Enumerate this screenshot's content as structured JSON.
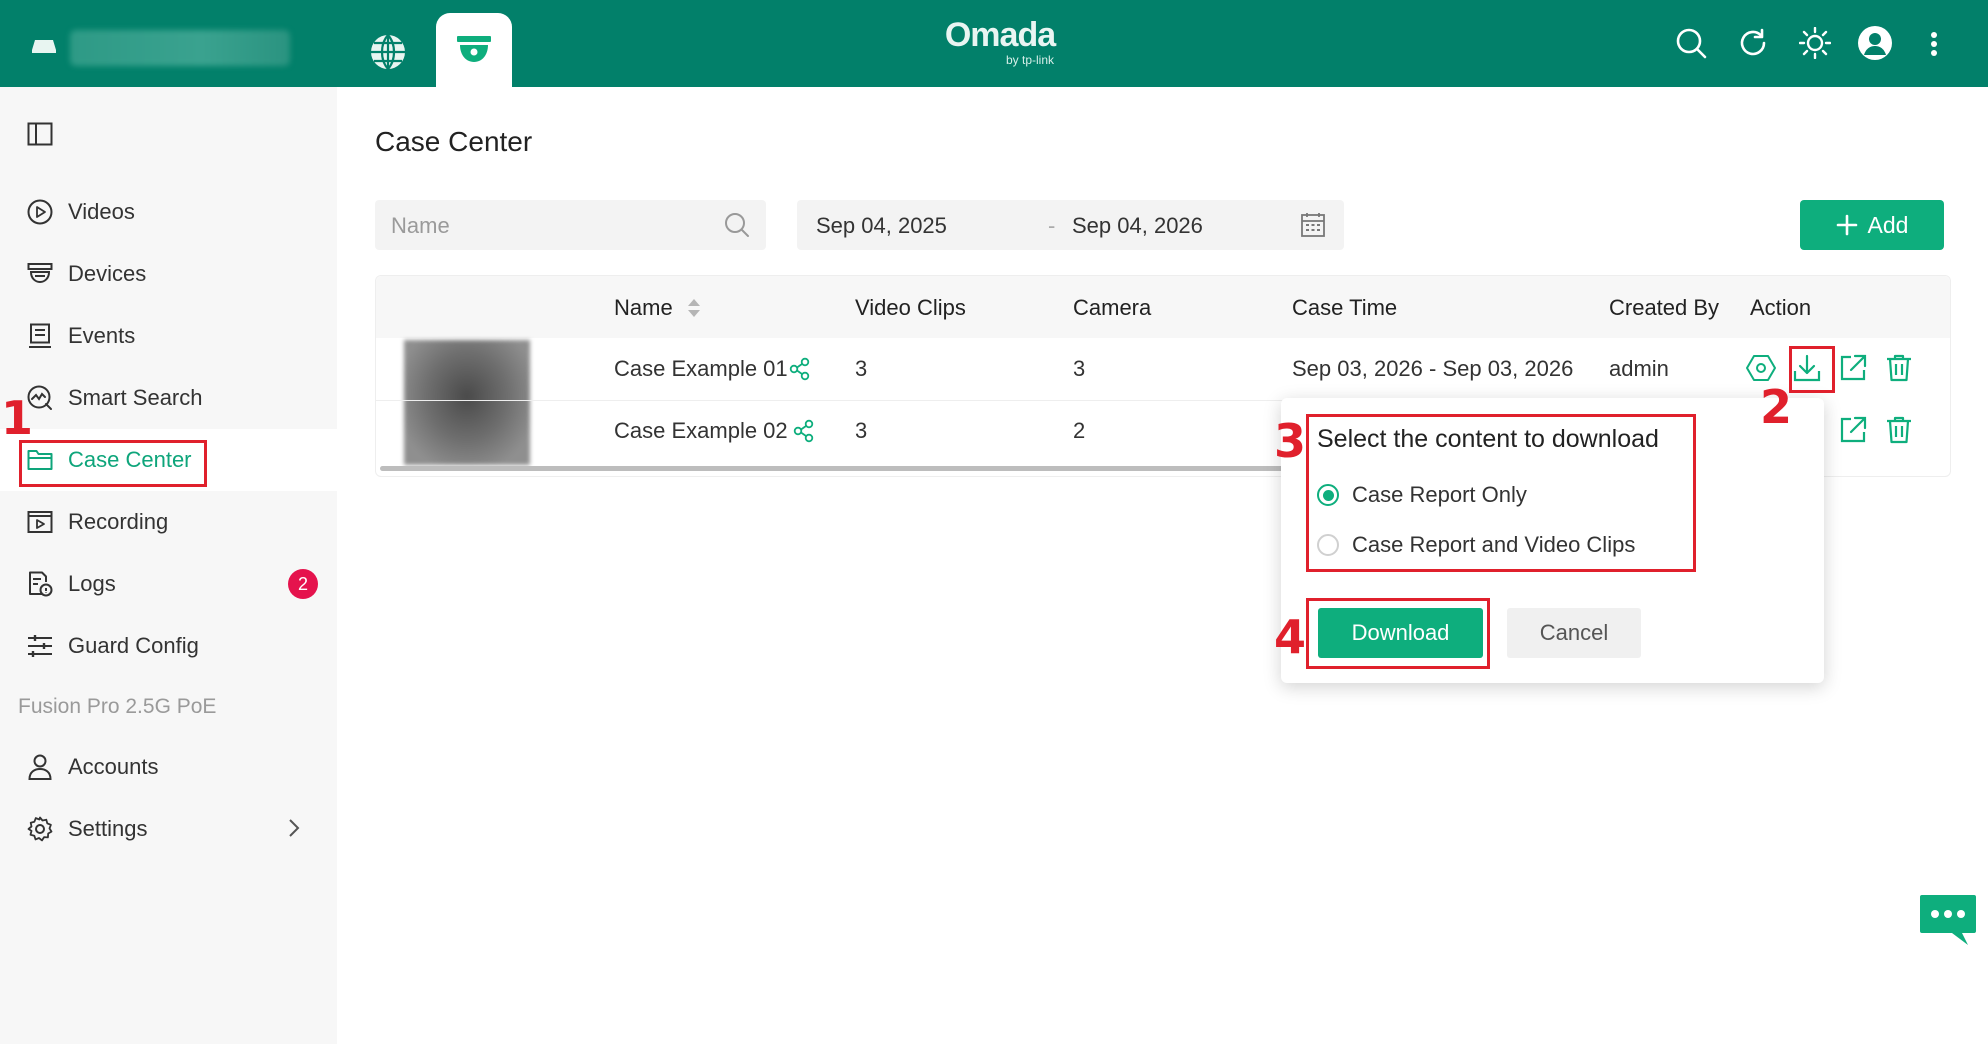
{
  "header": {
    "logo_main": "Omada",
    "logo_sub": "by tp-link"
  },
  "sidebar": {
    "items": [
      {
        "label": "Videos"
      },
      {
        "label": "Devices"
      },
      {
        "label": "Events"
      },
      {
        "label": "Smart Search"
      },
      {
        "label": "Case Center"
      },
      {
        "label": "Recording"
      },
      {
        "label": "Logs",
        "badge": "2"
      },
      {
        "label": "Guard Config"
      }
    ],
    "section": "Fusion Pro 2.5G PoE",
    "bottom_items": [
      {
        "label": "Accounts"
      },
      {
        "label": "Settings"
      }
    ]
  },
  "main": {
    "title": "Case Center",
    "search_placeholder": "Name",
    "date_start": "Sep 04, 2025",
    "date_sep": "-",
    "date_end": "Sep 04, 2026",
    "add_label": "Add"
  },
  "table": {
    "columns": [
      "Name",
      "Video Clips",
      "Camera",
      "Case Time",
      "Created By",
      "Action"
    ],
    "rows": [
      {
        "name": "Case Example 01",
        "clips": "3",
        "camera": "3",
        "time": "Sep 03, 2026 - Sep 03, 2026",
        "created_by": "admin"
      },
      {
        "name": "Case Example 02",
        "clips": "3",
        "camera": "2",
        "time": "",
        "created_by": ""
      }
    ]
  },
  "popover": {
    "title": "Select the content to download",
    "options": [
      "Case Report Only",
      "Case Report and Video Clips"
    ],
    "selected": 0,
    "download_label": "Download",
    "cancel_label": "Cancel"
  },
  "annotations": {
    "step1": "1",
    "step2": "2",
    "step3": "3",
    "step4": "4"
  },
  "colors": {
    "header": "#02806a",
    "accent": "#0eae7d",
    "annotation": "#e0202c",
    "badge": "#e5134d"
  }
}
